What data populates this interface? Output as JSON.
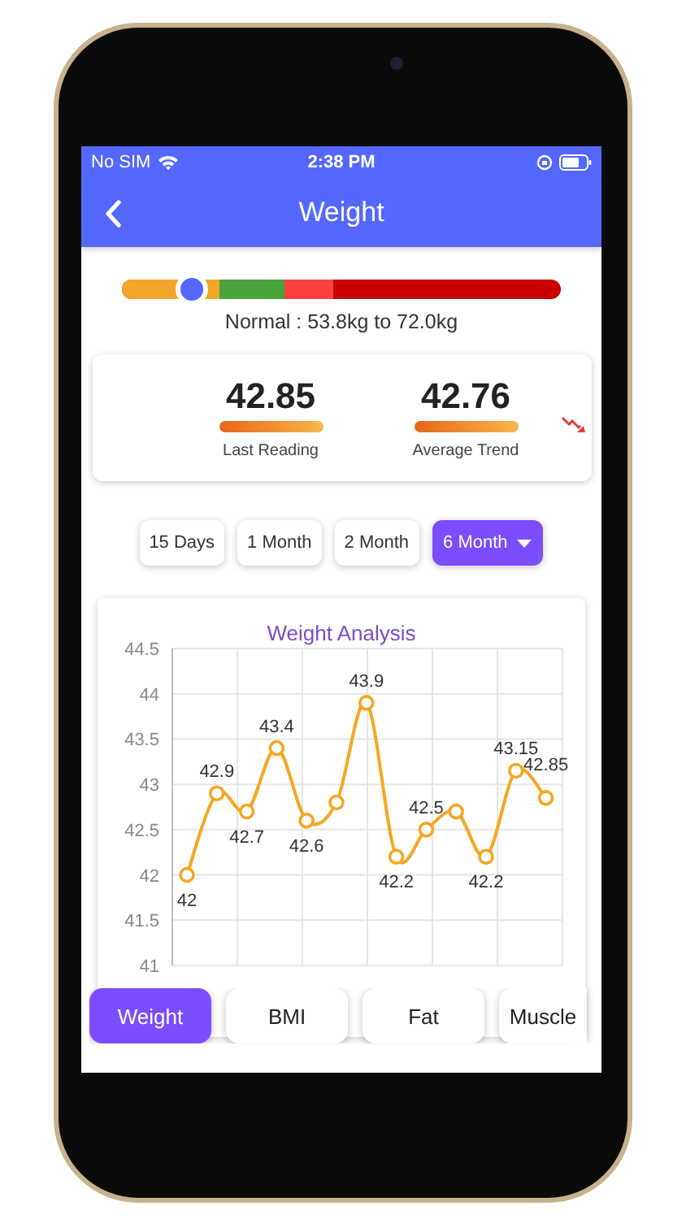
{
  "status_bar": {
    "carrier": "No SIM",
    "time": "2:38 PM"
  },
  "header": {
    "title": "Weight"
  },
  "range": {
    "level": 0.16,
    "label": "Normal : 53.8kg to 72.0kg"
  },
  "stats": [
    {
      "value": "42.85",
      "label": "Last Reading",
      "falling": false
    },
    {
      "value": "42.76",
      "label": "Average Trend",
      "falling": true
    }
  ],
  "periods": [
    {
      "label": "15 Days",
      "selected": false
    },
    {
      "label": "1 Month",
      "selected": false
    },
    {
      "label": "2 Month",
      "selected": false
    },
    {
      "label": "6 Month",
      "selected": true
    }
  ],
  "chart": {
    "chart_data": {
      "type": "line",
      "title": "Weight Analysis",
      "ylim": [
        41,
        44.5
      ],
      "yticks": [
        41,
        41.5,
        42,
        42.5,
        43,
        43.5,
        44,
        44.5
      ],
      "grid": true,
      "series": [
        {
          "color": "#f5a623",
          "marker": true,
          "values": [
            42,
            42.9,
            42.7,
            43.4,
            42.6,
            42.8,
            43.9,
            42.2,
            42.5,
            42.7,
            42.2,
            43.15,
            42.85
          ]
        }
      ],
      "value_labels": [
        "42",
        "42.9",
        "42.7",
        "43.4",
        "42.6",
        null,
        "43.9",
        "42.2",
        "42.5",
        null,
        "42.2",
        "43.15",
        "42.85"
      ]
    }
  },
  "metric_tabs": [
    {
      "label": "Weight",
      "selected": true
    },
    {
      "label": "BMI",
      "selected": false
    },
    {
      "label": "Fat",
      "selected": false
    },
    {
      "label": "Muscle",
      "selected": false
    }
  ]
}
